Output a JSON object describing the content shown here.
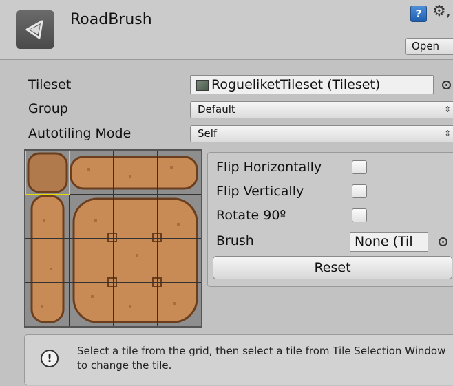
{
  "header": {
    "title": "RoadBrush",
    "open_label": "Open",
    "help_glyph": "?",
    "gear_glyph": "⚙,"
  },
  "properties": {
    "tileset_label": "Tileset",
    "tileset_value": "RogueliketTileset (Tileset)",
    "group_label": "Group",
    "group_value": "Default",
    "autotiling_label": "Autotiling Mode",
    "autotiling_value": "Self",
    "dropdown_arrows": "⇕"
  },
  "options": {
    "flip_h_label": "Flip Horizontally",
    "flip_v_label": "Flip Vertically",
    "rotate_label": "Rotate 90º",
    "brush_label": "Brush",
    "brush_value": "None (Til",
    "reset_label": "Reset"
  },
  "help": {
    "icon_glyph": "!",
    "text": "Select  a tile from the grid, then select a tile from Tile Selection Window to change the tile."
  },
  "colors": {
    "tile_fill": "#c98b55",
    "tile_edge": "#6b3f1e",
    "selection": "#e8d800"
  }
}
